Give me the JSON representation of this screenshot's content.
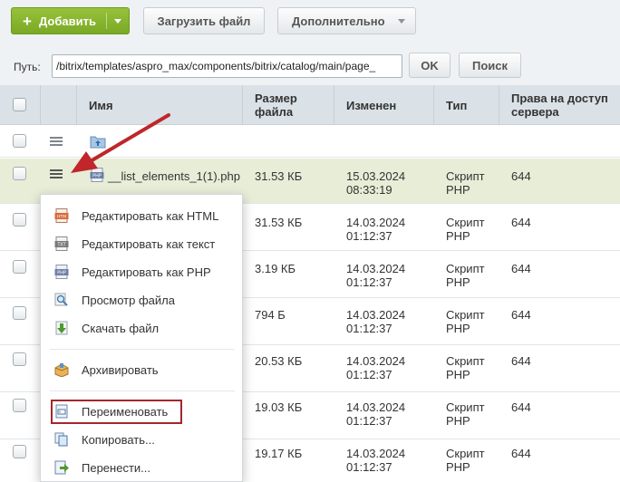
{
  "toolbar": {
    "add_label": "Добавить",
    "upload_label": "Загрузить файл",
    "more_label": "Дополнительно"
  },
  "pathbar": {
    "label": "Путь:",
    "value": "/bitrix/templates/aspro_max/components/bitrix/catalog/main/page_",
    "ok_label": "OK",
    "search_label": "Поиск"
  },
  "table": {
    "columns": {
      "name": "Имя",
      "size": "Размер файла",
      "modified": "Изменен",
      "type": "Тип",
      "rights": "Права на доступ сервера"
    },
    "rows": [
      {
        "name": "__list_elements_1(1).php",
        "size": "31.53 КБ",
        "date": "15.03.2024",
        "time": "08:33:19",
        "type1": "Скрипт",
        "type2": "PHP",
        "rights": "644"
      },
      {
        "name": "",
        "size": "31.53 КБ",
        "date": "14.03.2024",
        "time": "01:12:37",
        "type1": "Скрипт",
        "type2": "PHP",
        "rights": "644"
      },
      {
        "name": "",
        "size": "3.19 КБ",
        "date": "14.03.2024",
        "time": "01:12:37",
        "type1": "Скрипт",
        "type2": "PHP",
        "rights": "644"
      },
      {
        "name": "",
        "size": "794 Б",
        "date": "14.03.2024",
        "time": "01:12:37",
        "type1": "Скрипт",
        "type2": "PHP",
        "rights": "644"
      },
      {
        "name": "",
        "size": "20.53 КБ",
        "date": "14.03.2024",
        "time": "01:12:37",
        "type1": "Скрипт",
        "type2": "PHP",
        "rights": "644"
      },
      {
        "name": "",
        "size": "19.03 КБ",
        "date": "14.03.2024",
        "time": "01:12:37",
        "type1": "Скрипт",
        "type2": "PHP",
        "rights": "644"
      },
      {
        "name": "",
        "size": "19.17 КБ",
        "date": "14.03.2024",
        "time": "01:12:37",
        "type1": "Скрипт",
        "type2": "PHP",
        "rights": "644"
      }
    ]
  },
  "menu": {
    "items": [
      {
        "label": "Редактировать как HTML",
        "icon": "html-file-icon"
      },
      {
        "label": "Редактировать как текст",
        "icon": "txt-file-icon"
      },
      {
        "label": "Редактировать как PHP",
        "icon": "php-file-icon"
      },
      {
        "label": "Просмотр файла",
        "icon": "magnifier-icon"
      },
      {
        "label": "Скачать файл",
        "icon": "download-icon"
      },
      {
        "label": "Архивировать",
        "icon": "archive-box-icon"
      },
      {
        "label": "Переименовать",
        "icon": "rename-icon"
      },
      {
        "label": "Копировать...",
        "icon": "copy-icon"
      },
      {
        "label": "Перенести...",
        "icon": "move-icon"
      }
    ]
  },
  "colors": {
    "accent_green": "#7aa925",
    "header_bg": "#dbe2e7",
    "active_row": "#e8edd8",
    "arrow_red": "#c0262a",
    "highlight_frame": "#a4262c"
  }
}
